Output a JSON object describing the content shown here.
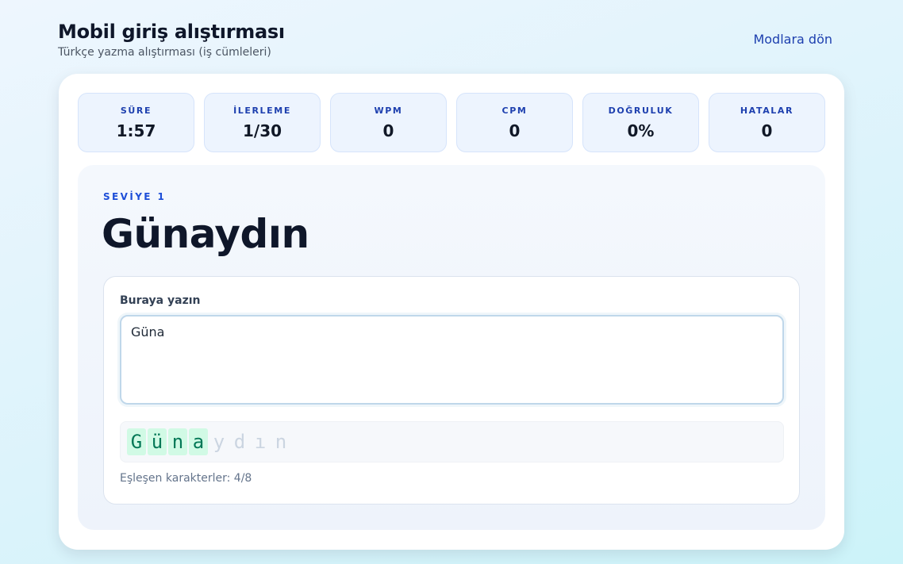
{
  "header": {
    "title": "Mobil giriş alıştırması",
    "subtitle": "Türkçe yazma alıştırması (iş cümleleri)",
    "back_link": "Modlara dön"
  },
  "stats": [
    {
      "label": "SÜRE",
      "value": "1:57"
    },
    {
      "label": "İLERLEME",
      "value": "1/30"
    },
    {
      "label": "WPM",
      "value": "0"
    },
    {
      "label": "CPM",
      "value": "0"
    },
    {
      "label": "DOĞRULUK",
      "value": "0%"
    },
    {
      "label": "HATALAR",
      "value": "0"
    }
  ],
  "exercise": {
    "level": "SEVİYE 1",
    "target": "Günaydın",
    "input_label": "Buraya yazın",
    "input_value": "Güna",
    "chars": [
      {
        "char": "G",
        "state": "correct"
      },
      {
        "char": "ü",
        "state": "correct"
      },
      {
        "char": "n",
        "state": "correct"
      },
      {
        "char": "a",
        "state": "correct"
      },
      {
        "char": "y",
        "state": "pending"
      },
      {
        "char": "d",
        "state": "pending"
      },
      {
        "char": "ı",
        "state": "pending"
      },
      {
        "char": "n",
        "state": "pending"
      }
    ],
    "match_text": "Eşleşen karakterler: 4/8"
  },
  "colors": {
    "accent": "#1e40af",
    "correct_bg": "#d1fae5",
    "correct_text": "#047857",
    "pending_text": "#cbd5e1"
  }
}
